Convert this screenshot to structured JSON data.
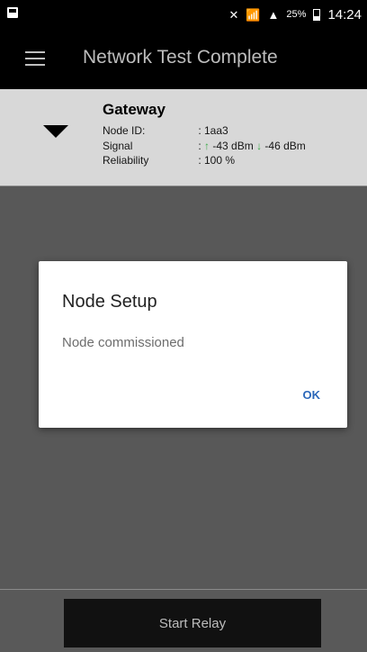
{
  "status_bar": {
    "battery": "25%",
    "time": "14:24"
  },
  "app_bar": {
    "title": "Network Test Complete"
  },
  "gateway": {
    "name": "Gateway",
    "rows": [
      {
        "label": "Node ID:",
        "value": ": 1aa3"
      },
      {
        "label": "Signal",
        "value": ":",
        "up_value": "-43 dBm",
        "down_value": "-46 dBm"
      },
      {
        "label": "Reliability",
        "value": ": 100 %"
      }
    ]
  },
  "dialog": {
    "title": "Node Setup",
    "message": "Node commissioned",
    "ok_label": "OK"
  },
  "footer": {
    "start_label": "Start Relay"
  }
}
